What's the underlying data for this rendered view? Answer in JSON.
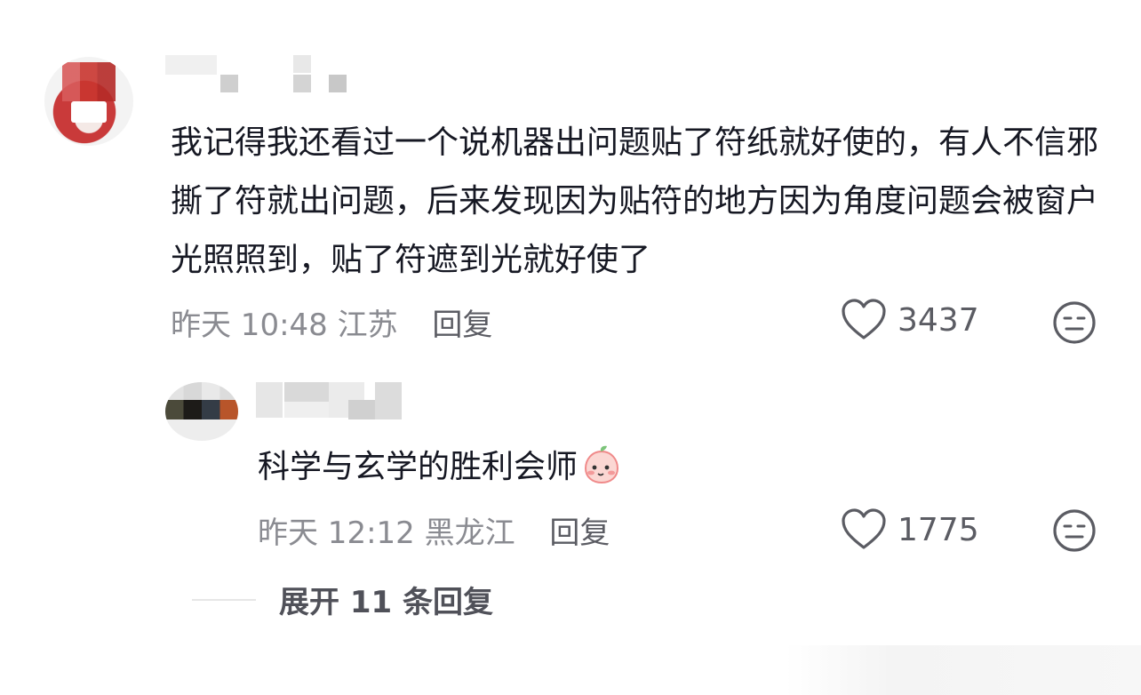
{
  "comment": {
    "text": "我记得我还看过一个说机器出问题贴了符纸就好使的，有人不信邪撕了符就出问题，后来发现因为贴符的地方因为角度问题会被窗户光照照到，贴了符遮到光就好使了",
    "time": "昨天 10:48",
    "location": "江苏",
    "reply_label": "回复",
    "likes": "3437",
    "avatar_icon": "avatar-image-blurred",
    "dislike_icon": "neutral-face-icon",
    "like_icon": "heart-outline-icon"
  },
  "reply": {
    "text": "科学与玄学的胜利会师",
    "emoji_icon": "blushing-peach-emoji",
    "time": "昨天 12:12",
    "location": "黑龙江",
    "reply_label": "回复",
    "likes": "1775"
  },
  "expand": {
    "label": "展开 11 条回复"
  },
  "colors": {
    "text": "#161823",
    "meta": "#8a8b91",
    "accent_emoji": "#f08a8a"
  }
}
